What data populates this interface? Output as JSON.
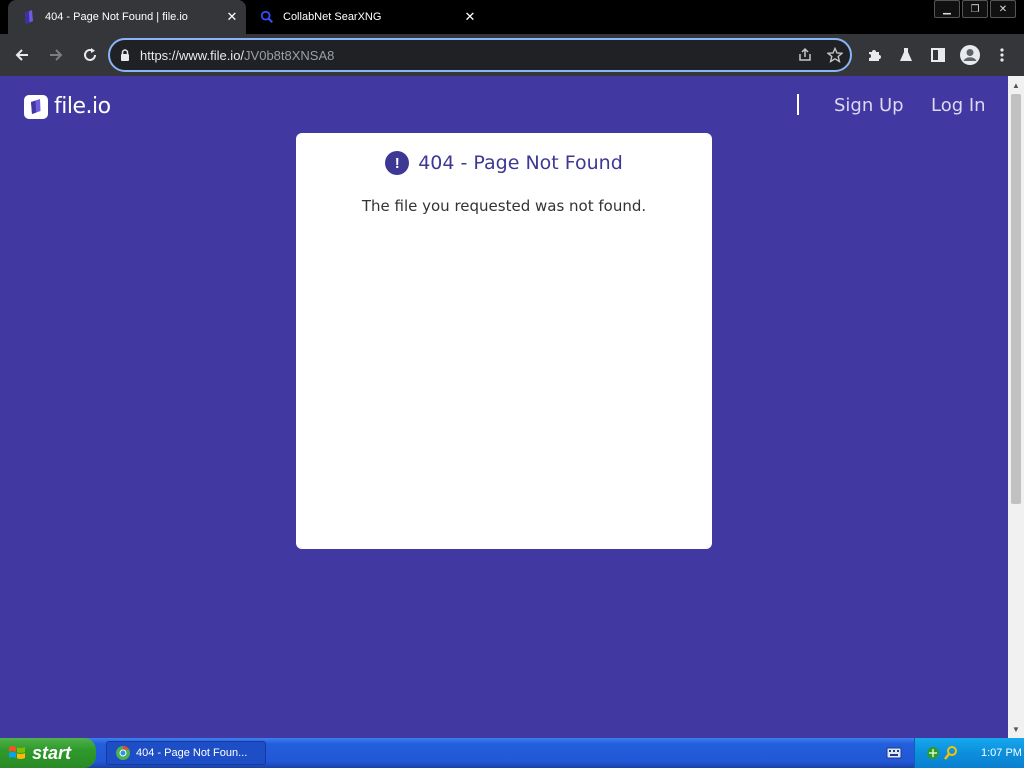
{
  "browser": {
    "tabs": [
      {
        "title": "404 - Page Not Found | file.io",
        "active": true,
        "favicon": "fileio-favicon"
      },
      {
        "title": "CollabNet SearXNG",
        "active": false,
        "favicon": "search-favicon"
      }
    ],
    "address_url_host": "https://www.file.io/",
    "address_url_path": "JV0b8t8XNSA8"
  },
  "page": {
    "brand_name": "file.io",
    "nav": {
      "signup_label": "Sign Up",
      "login_label": "Log In"
    },
    "card": {
      "title": "404 - Page Not Found",
      "message": "The file you requested was not found."
    }
  },
  "taskbar": {
    "start_label": "start",
    "task_label": "404 - Page Not Foun...",
    "clock": "1:07 PM"
  },
  "colors": {
    "page_bg": "#4139a1",
    "accent": "#3d3893",
    "omnibox_focus": "#8ab4f8"
  }
}
